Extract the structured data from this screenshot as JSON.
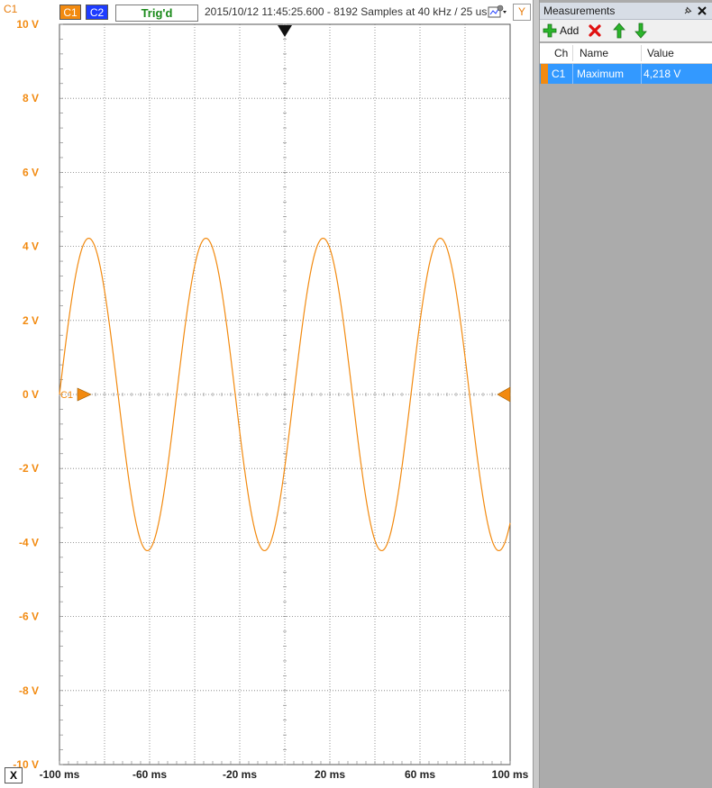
{
  "scope": {
    "channel_axis_label": "C1",
    "ch1_button_label": "C1",
    "ch2_button_label": "C2",
    "trigger_status": "Trig'd",
    "acquisition_info": "2015/10/12  11:45:25.600 - 8192 Samples at 40 kHz / 25 us",
    "y_button_label": "Y",
    "x_button_label": "X",
    "channel_marker_label": "C1",
    "colors": {
      "ch1": "#f28a10",
      "ch2": "#1e3cff",
      "grid": "#7a7a7a",
      "trigger_ok": "#1a8a1a"
    }
  },
  "chart_data": {
    "type": "line",
    "title": "",
    "xlabel": "",
    "ylabel": "",
    "xlim": [
      -100,
      100
    ],
    "ylim": [
      -10,
      10
    ],
    "x_ticks": [
      -100,
      -80,
      -60,
      -40,
      -20,
      0,
      20,
      40,
      60,
      80,
      100
    ],
    "x_tick_labels": [
      "-100 ms",
      "-60 ms",
      "-20 ms",
      "20 ms",
      "60 ms",
      "100 ms"
    ],
    "x_tick_label_values": [
      -100,
      -60,
      -20,
      20,
      60,
      100
    ],
    "y_ticks": [
      10,
      8,
      6,
      4,
      2,
      0,
      -2,
      -4,
      -6,
      -8,
      -10
    ],
    "y_tick_labels": [
      "10 V",
      "8 V",
      "6 V",
      "4 V",
      "2 V",
      "0 V",
      "-2 V",
      "-4 V",
      "-6 V",
      "-8 V",
      "-10 V"
    ],
    "grid": true,
    "trigger_time_ms": 0,
    "series": [
      {
        "name": "C1",
        "color": "#f28a10",
        "amplitude_v": 4.22,
        "period_ms": 52,
        "x": [
          -100,
          -96,
          -92,
          -89,
          -86,
          -83,
          -80,
          -76,
          -72,
          -68,
          -64,
          -61,
          -58,
          -55,
          -52,
          -48,
          -44,
          -41,
          -37,
          -34,
          -31,
          -28,
          -24,
          -20,
          -16,
          -13,
          -10,
          -7,
          -4,
          0,
          4,
          8,
          11,
          14,
          17,
          20,
          24,
          28,
          32,
          35,
          38,
          41,
          44,
          48,
          52,
          56,
          59,
          62,
          65,
          68,
          72,
          76,
          80,
          83,
          86,
          89,
          92,
          96,
          100
        ],
        "y": [
          0.0,
          2.5,
          3.9,
          4.22,
          3.6,
          2.4,
          0.5,
          -1.6,
          -3.2,
          -4.0,
          -4.2,
          -3.7,
          -2.7,
          -1.3,
          0.2,
          2.1,
          3.6,
          4.22,
          3.8,
          2.7,
          1.3,
          -0.5,
          -2.3,
          -3.7,
          -4.22,
          -3.8,
          -2.8,
          -1.4,
          0.2,
          0.0,
          2.4,
          3.8,
          4.22,
          3.7,
          2.6,
          1.0,
          -1.3,
          -3.1,
          -4.1,
          -4.2,
          -3.6,
          -2.4,
          -1.0,
          0.9,
          2.8,
          4.0,
          4.22,
          3.6,
          2.5,
          0.9,
          -1.5,
          -3.3,
          -4.2,
          -4.1,
          -3.3,
          -2.0,
          -0.6,
          1.5,
          0.0
        ]
      }
    ]
  },
  "measurements": {
    "title": "Measurements",
    "add_label": "Add",
    "columns": [
      "Ch",
      "Name",
      "Value"
    ],
    "rows": [
      {
        "ch": "C1",
        "name": "Maximum",
        "value": "4,218 V"
      }
    ]
  }
}
